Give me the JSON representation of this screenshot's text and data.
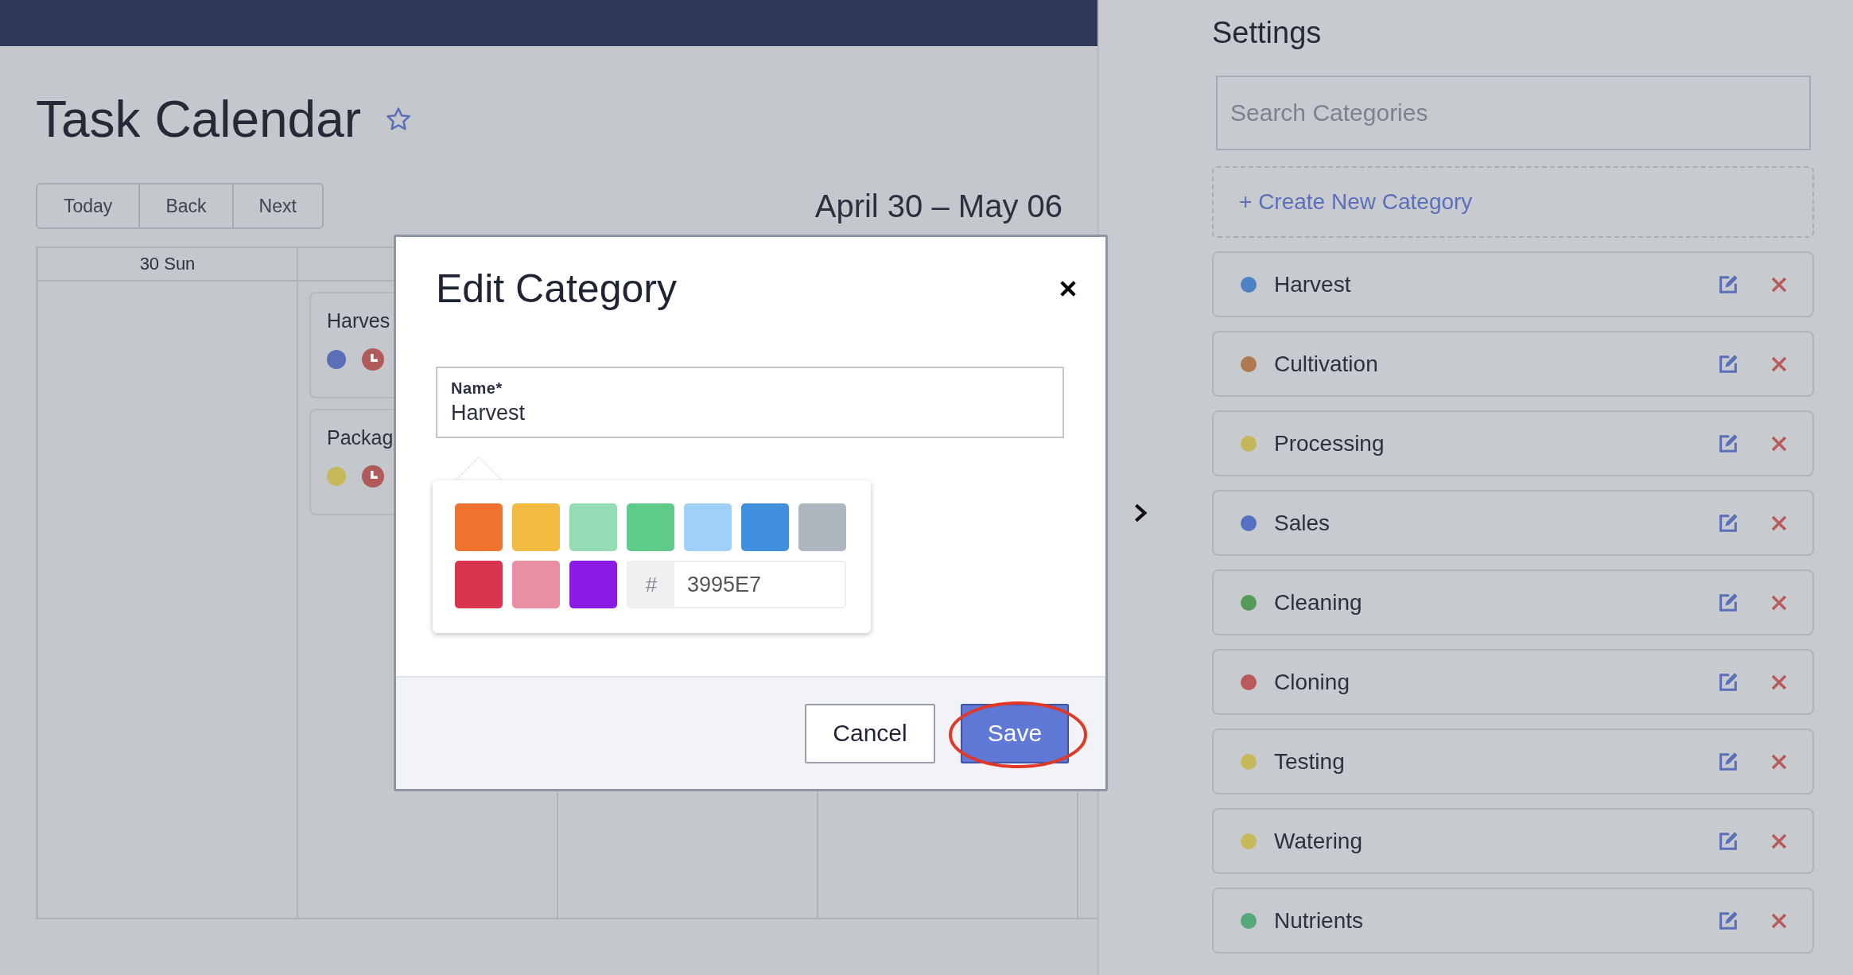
{
  "page": {
    "title": "Task Calendar",
    "favorite": false
  },
  "nav_buttons": [
    "Today",
    "Back",
    "Next"
  ],
  "date_range": "April 30 – May 06",
  "calendar": {
    "day_headers": [
      "30 Sun"
    ],
    "events": [
      {
        "title": "Harves",
        "color": "#5b6fb9"
      },
      {
        "title": "Packag",
        "color": "#c6b75a"
      }
    ]
  },
  "dialog": {
    "title": "Edit Category",
    "name_field": {
      "label": "Name*",
      "value": "Harvest"
    },
    "swatches": [
      {
        "color": "#ee7230"
      },
      {
        "color": "#f2bb41"
      },
      {
        "color": "#94dcb4"
      },
      {
        "color": "#5ecb88"
      },
      {
        "color": "#a0cff7"
      },
      {
        "color": "#4190dd"
      },
      {
        "color": "#aeb6c0"
      },
      {
        "color": "#d93550"
      },
      {
        "color": "#e88fa3"
      },
      {
        "color": "#8b1ce6"
      }
    ],
    "hex_field": {
      "prefix": "#",
      "value": "3995E7"
    },
    "buttons": [
      {
        "label": "Cancel",
        "kind": "secondary"
      },
      {
        "label": "Save",
        "kind": "primary"
      }
    ]
  },
  "settings": {
    "title": "Settings",
    "search": {
      "placeholder": "Search Categories"
    },
    "create_label": "+ Create New Category",
    "categories": [
      {
        "name": "Harvest",
        "color": "#4f82c3"
      },
      {
        "name": "Cultivation",
        "color": "#b07a50"
      },
      {
        "name": "Processing",
        "color": "#c4b65a"
      },
      {
        "name": "Sales",
        "color": "#5470c0"
      },
      {
        "name": "Cleaning",
        "color": "#559a59"
      },
      {
        "name": "Cloning",
        "color": "#b85a5a"
      },
      {
        "name": "Testing",
        "color": "#c6b95a"
      },
      {
        "name": "Watering",
        "color": "#c6b95a"
      },
      {
        "name": "Nutrients",
        "color": "#54a87a"
      }
    ]
  }
}
